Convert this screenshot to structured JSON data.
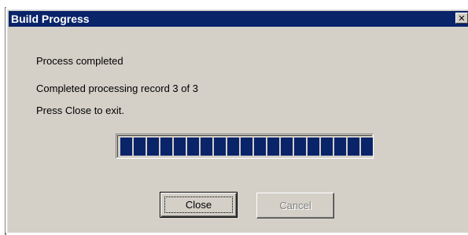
{
  "window": {
    "title": "Build Progress",
    "close_glyph": "✕",
    "titlebar_color": "#0a246a"
  },
  "messages": {
    "status": "Process completed",
    "record_progress": "Completed processing record 3 of 3",
    "instruction": "Press Close to exit."
  },
  "progress": {
    "percent": 100,
    "chunk_color": "#0a246a"
  },
  "buttons": {
    "close_label": "Close",
    "cancel_label": "Cancel",
    "cancel_enabled": false
  }
}
